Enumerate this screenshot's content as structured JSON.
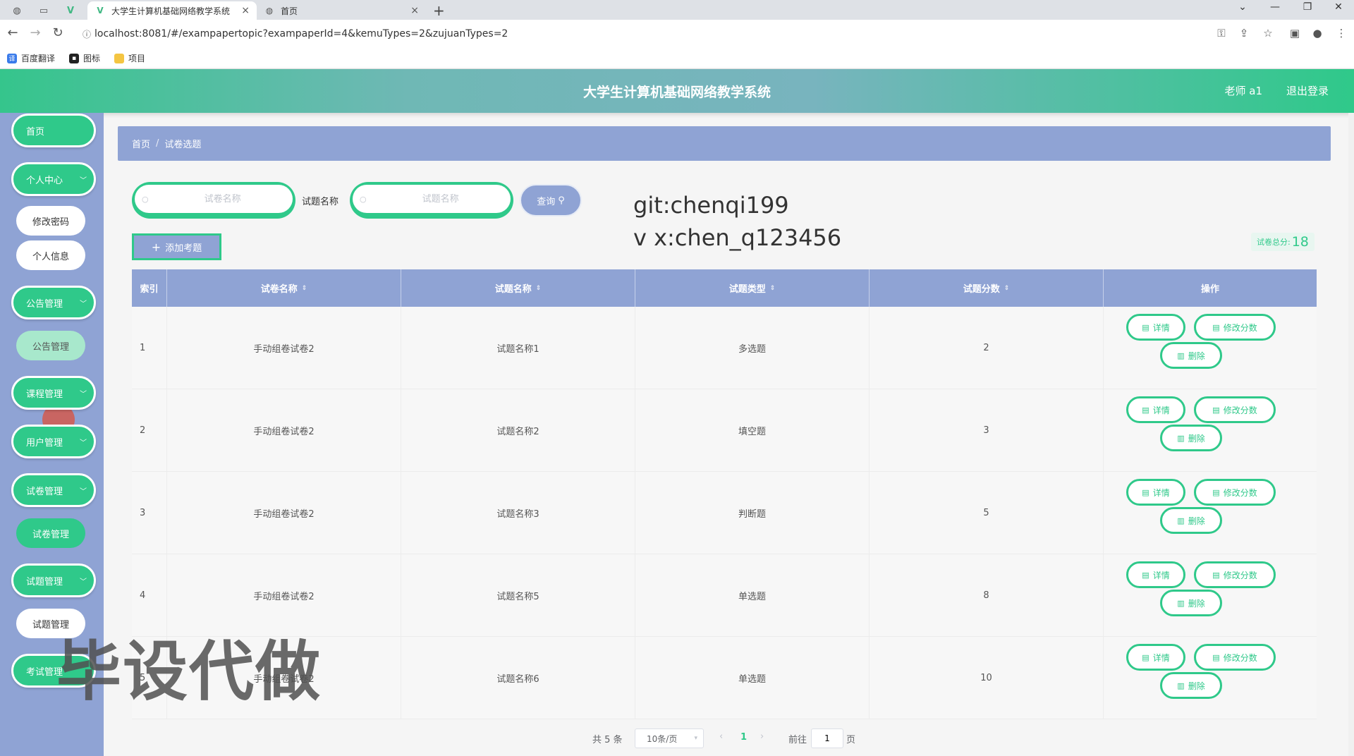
{
  "browser": {
    "tabs": [
      {
        "title": "大学生计算机基础网络教学系统",
        "active": true
      },
      {
        "title": "首页",
        "active": false
      }
    ],
    "url": "localhost:8081/#/exampapertopic?exampaperId=4&kemuTypes=2&zujuanTypes=2",
    "bookmarks": [
      "百度翻译",
      "图标",
      "项目"
    ]
  },
  "header": {
    "title": "大学生计算机基础网络教学系统",
    "user": "老师 a1",
    "logout": "退出登录"
  },
  "sidebar": {
    "home": "首页",
    "personal": "个人中心",
    "change_password": "修改密码",
    "personal_info": "个人信息",
    "notice": "公告管理",
    "notice_sub": "公告管理",
    "course": "课程管理",
    "user": "用户管理",
    "exam_paper": "试卷管理",
    "exam_paper_sub": "试卷管理",
    "question": "试题管理",
    "question_sub": "试题管理",
    "exam": "考试管理"
  },
  "breadcrumb": {
    "home": "首页",
    "current": "试卷选题"
  },
  "search": {
    "paper_placeholder": "试卷名称",
    "question_label": "试题名称",
    "question_placeholder": "试题名称",
    "query_button": "查询"
  },
  "add_button": "添加考题",
  "overlay_text": {
    "line1": "git:chenqi199",
    "line2": "v x:chen_q123456"
  },
  "total_score": {
    "label": "试卷总分:",
    "value": "18"
  },
  "table": {
    "headers": [
      "索引",
      "试卷名称",
      "试题名称",
      "试题类型",
      "试题分数",
      "操作"
    ],
    "rows": [
      {
        "idx": "1",
        "paper": "手动组卷试卷2",
        "question": "试题名称1",
        "type": "多选题",
        "score": "2"
      },
      {
        "idx": "2",
        "paper": "手动组卷试卷2",
        "question": "试题名称2",
        "type": "填空题",
        "score": "3"
      },
      {
        "idx": "3",
        "paper": "手动组卷试卷2",
        "question": "试题名称3",
        "type": "判断题",
        "score": "5"
      },
      {
        "idx": "4",
        "paper": "手动组卷试卷2",
        "question": "试题名称5",
        "type": "单选题",
        "score": "8"
      },
      {
        "idx": "5",
        "paper": "手动组卷试卷2",
        "question": "试题名称6",
        "type": "单选题",
        "score": "10"
      }
    ],
    "ops": {
      "detail": "详情",
      "edit_score": "修改分数",
      "delete": "删除"
    }
  },
  "pagination": {
    "total": "共 5 条",
    "page_size": "10条/页",
    "current_page": "1",
    "goto_label": "前往",
    "goto_value": "1",
    "page_suffix": "页"
  },
  "watermark": "毕设代做",
  "colors": {
    "accent": "#2fc98a",
    "sidebar": "#8fa3d4",
    "header_mid": "#78b4be"
  }
}
